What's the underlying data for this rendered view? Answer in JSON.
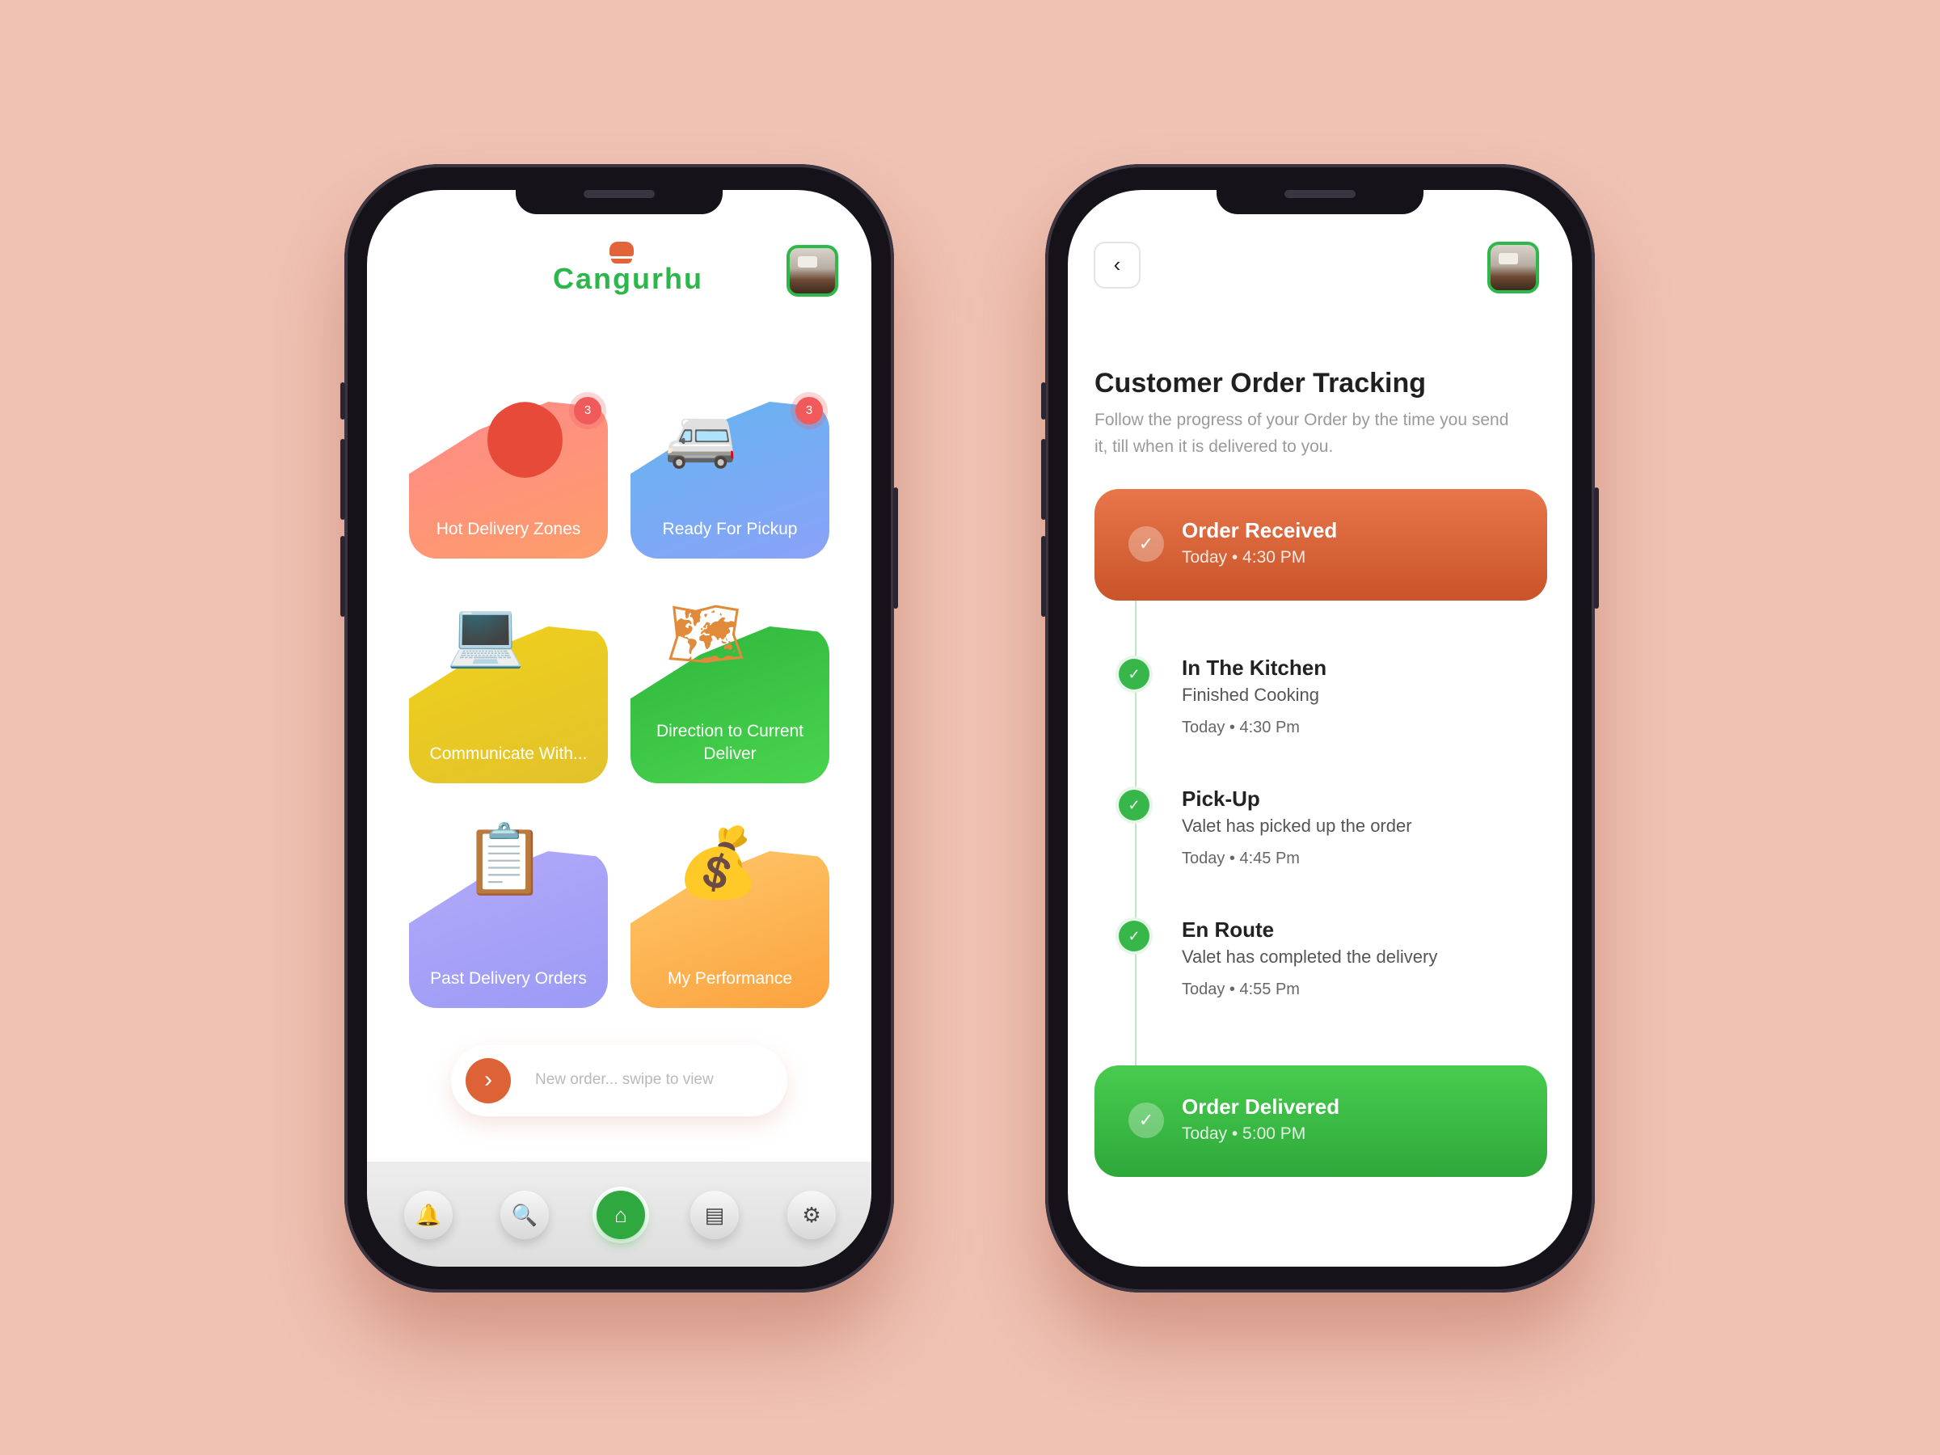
{
  "colors": {
    "background": "#efc2b3",
    "brand_green": "#2db64a",
    "brand_orange": "#dd6337"
  },
  "home": {
    "logo_text": "Cangurhu",
    "tiles": [
      {
        "label": "Hot Delivery Zones",
        "badge": "3",
        "icon": "location-pin-icon",
        "color": "#fb7a6e"
      },
      {
        "label": "Ready For Pickup",
        "badge": "3",
        "icon": "delivery-van-icon",
        "color": "#6fa8f4"
      },
      {
        "label": "Communicate With...",
        "badge": null,
        "icon": "laptop-phone-icon",
        "color": "#e8cf1e"
      },
      {
        "label": "Direction to Current Deliver",
        "badge": null,
        "icon": "map-icon",
        "color": "#36c345"
      },
      {
        "label": "Past Delivery Orders",
        "badge": null,
        "icon": "clipboard-icon",
        "color": "#a9a5f8"
      },
      {
        "label": "My Performance",
        "badge": null,
        "icon": "money-bag-icon",
        "color": "#fba84a"
      }
    ],
    "swipe_hint": "New order... swipe to view",
    "nav": [
      "bell-icon",
      "search-icon",
      "home-icon",
      "chat-icon",
      "settings-icon"
    ]
  },
  "tracking": {
    "title": "Customer Order Tracking",
    "subtitle": "Follow the progress of your Order by the time you send it, till when it is delivered to you.",
    "received": {
      "title": "Order Received",
      "time": "Today • 4:30 PM"
    },
    "steps": [
      {
        "title": "In The Kitchen",
        "desc": "Finished Cooking",
        "time": "Today • 4:30 Pm"
      },
      {
        "title": "Pick-Up",
        "desc": "Valet has picked up the order",
        "time": "Today • 4:45 Pm"
      },
      {
        "title": "En Route",
        "desc": "Valet has completed the delivery",
        "time": "Today • 4:55 Pm"
      }
    ],
    "delivered": {
      "title": "Order Delivered",
      "time": "Today • 5:00 PM"
    }
  }
}
